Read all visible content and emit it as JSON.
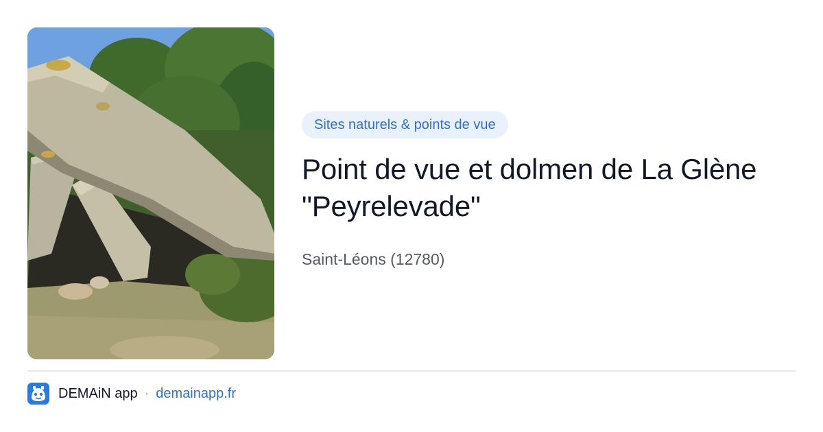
{
  "card": {
    "category": "Sites naturels & points de vue",
    "title": "Point de vue et dolmen de La Glène \"Peyrelevade\"",
    "location": "Saint-Léons (12780)"
  },
  "footer": {
    "app_name": "DEMAiN app",
    "separator": "·",
    "domain": "demainapp.fr"
  },
  "image": {
    "subject": "dolmen-photo"
  },
  "colors": {
    "badge_bg": "#e9f1fc",
    "accent": "#2f6fd6",
    "title": "#111827",
    "subtitle": "#555b66",
    "app_icon": "#2a7be0"
  }
}
